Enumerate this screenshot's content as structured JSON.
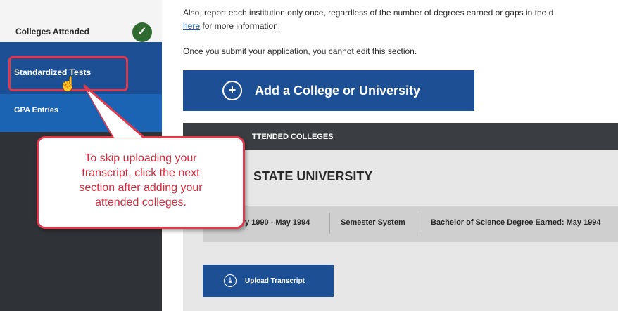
{
  "sidebar": {
    "items": [
      {
        "label": "Colleges Attended",
        "status": "complete"
      },
      {
        "label": "Standardized Tests"
      },
      {
        "label": "GPA Entries"
      }
    ]
  },
  "main": {
    "intro_line": "Also, report each institution only once, regardless of the number of degrees earned or gaps in the d",
    "here_link": "here",
    "here_suffix": " for more information.",
    "submit_note": "Once you submit your application, you cannot edit this section.",
    "add_button": "Add a College or University",
    "panel_header": "TTENDED COLLEGES",
    "university_name": "STATE UNIVERSITY",
    "info": {
      "dates": "y 1990 - May 1994",
      "system": "Semester System",
      "degree": "Bachelor of Science Degree Earned: May 1994"
    },
    "upload_button": "Upload Transcript"
  },
  "callout": {
    "lines": [
      "To skip uploading your",
      "transcript, click the next",
      "section after adding your",
      "attended colleges."
    ]
  },
  "icons": {
    "check": "check-icon",
    "hand": "hand-pointer-icon",
    "plus": "plus-circle-icon",
    "download": "download-icon"
  },
  "colors": {
    "primary_blue": "#1d4f95",
    "accent_red": "#e0384d",
    "success_green": "#2f6a31"
  }
}
